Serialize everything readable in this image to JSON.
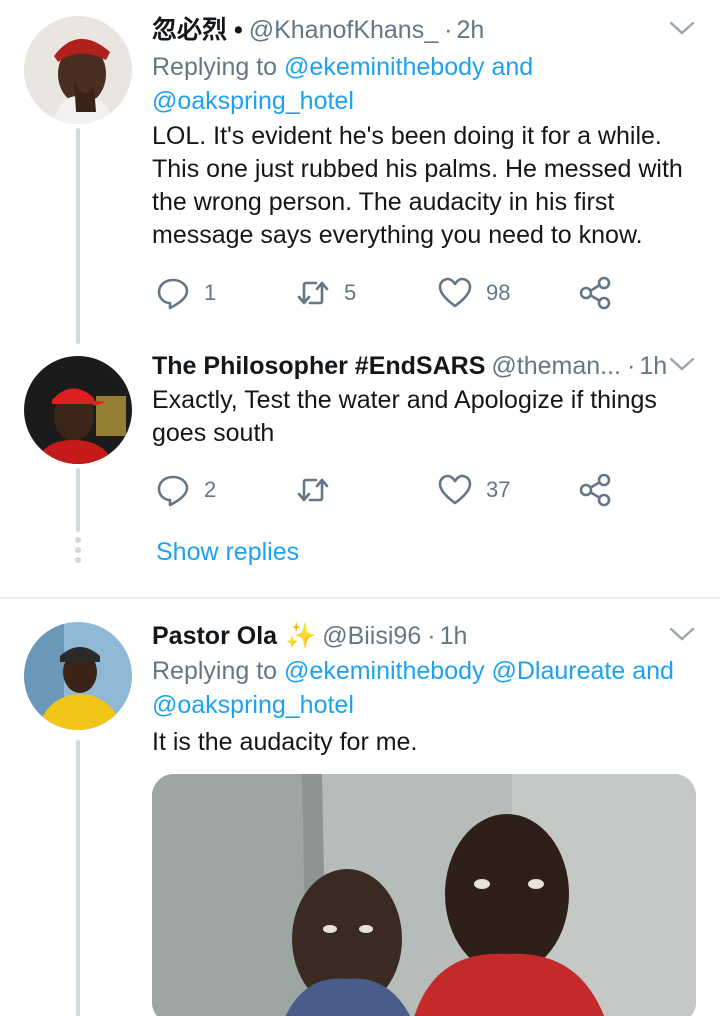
{
  "tweets": [
    {
      "name": "忽必烈 •",
      "handle": "@KhanofKhans_",
      "time": "2h",
      "reply_prefix": "Replying to ",
      "reply_mentions": [
        "@ekeminithebody",
        "and",
        "@oakspring_hotel"
      ],
      "text": "LOL. It's evident he's been doing it for a while. This one just rubbed his palms. He messed with the wrong person. The audacity in his first message says everything you need to know.",
      "replies": "1",
      "retweets": "5",
      "likes": "98"
    },
    {
      "name": "The Philosopher #EndSARS",
      "handle": "@theman...",
      "time": "1h",
      "text": "Exactly, Test the water and Apologize if things goes south",
      "replies": "2",
      "retweets": "",
      "likes": "37"
    },
    {
      "name": "Pastor Ola",
      "name_emoji": "✨",
      "handle": "@Biisi96",
      "time": "1h",
      "reply_prefix": "Replying to ",
      "reply_mentions": [
        "@ekeminithebody",
        "@Dlaureate",
        "and",
        "@oakspring_hotel"
      ],
      "text": "It is the audacity for me."
    }
  ],
  "show_replies_label": "Show replies",
  "separator_dot": "·",
  "colors": {
    "link": "#1da1f2",
    "muted": "#657786",
    "thread_line": "#cfd9de",
    "icon": "#657786"
  },
  "icons": [
    "chevron-down-icon",
    "reply-icon",
    "retweet-icon",
    "like-icon",
    "share-icon",
    "sparkles-icon"
  ]
}
